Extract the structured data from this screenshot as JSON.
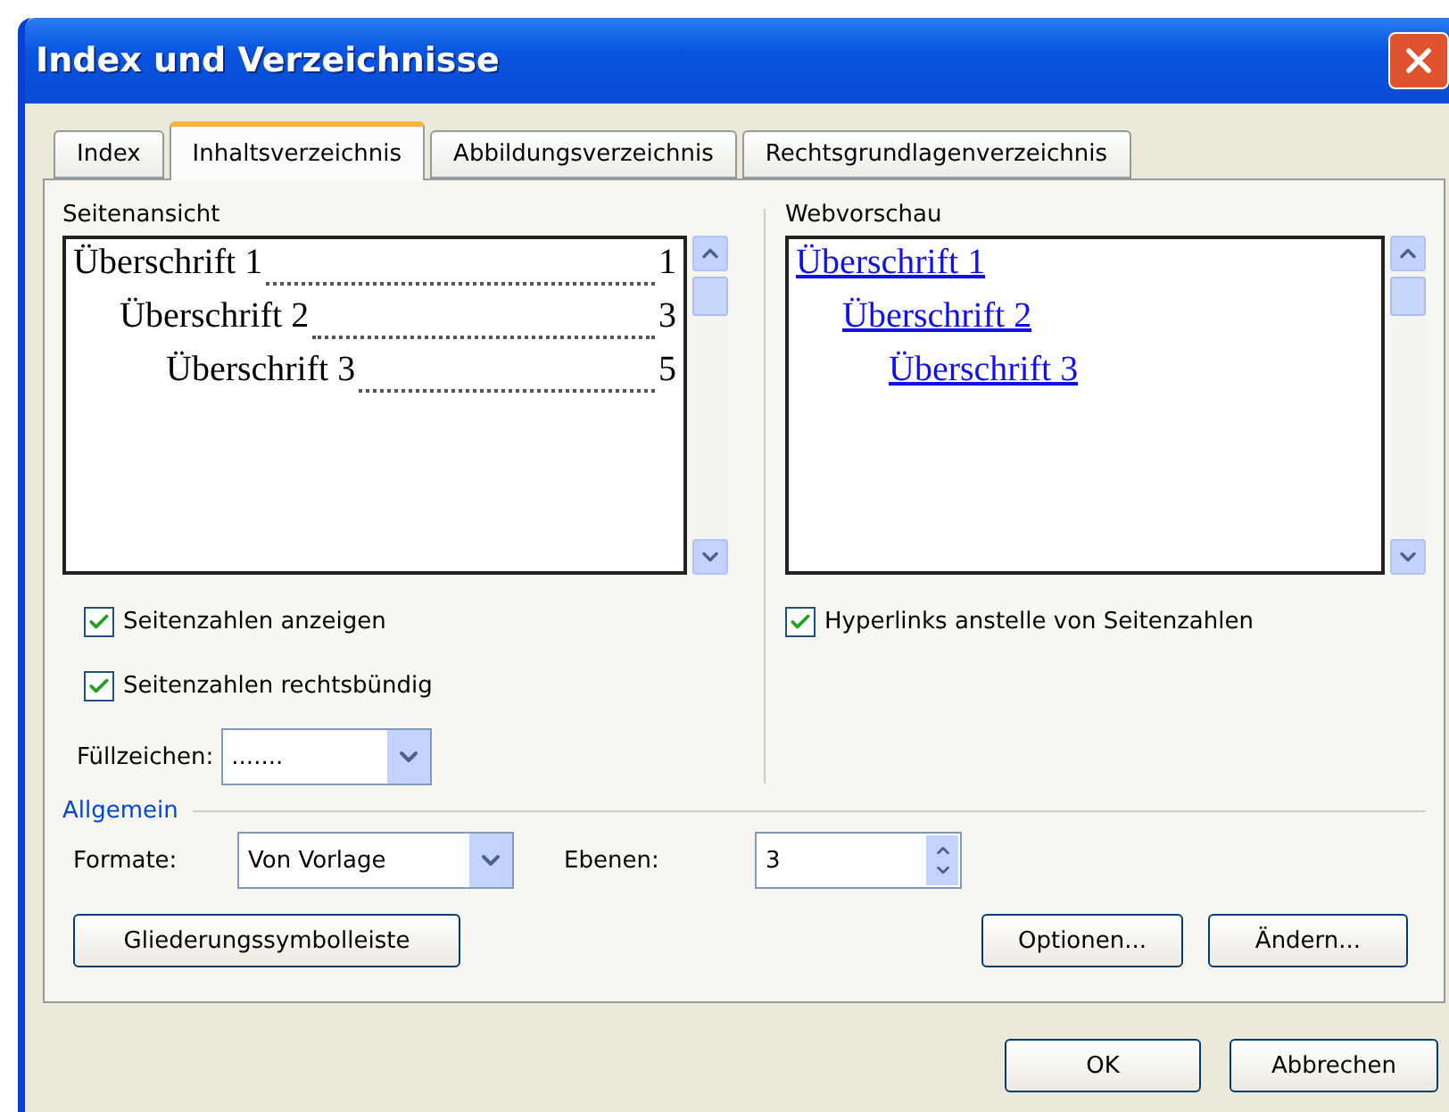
{
  "window": {
    "title": "Index und Verzeichnisse"
  },
  "tabs": [
    {
      "label": "Index",
      "selected": false
    },
    {
      "label": "Inhaltsverzeichnis",
      "selected": true
    },
    {
      "label": "Abbildungsverzeichnis",
      "selected": false
    },
    {
      "label": "Rechtsgrundlagenverzeichnis",
      "selected": false
    }
  ],
  "print_preview": {
    "label": "Seitenansicht",
    "entries": [
      {
        "text": "Überschrift 1",
        "page": "1",
        "children": [
          {
            "text": "Überschrift 2",
            "page": "3",
            "children": [
              {
                "text": "Überschrift 3",
                "page": "5"
              }
            ]
          }
        ]
      }
    ]
  },
  "web_preview": {
    "label": "Webvorschau",
    "entries": [
      {
        "text": "Überschrift 1",
        "children": [
          {
            "text": "Überschrift 2",
            "children": [
              {
                "text": "Überschrift 3"
              }
            ]
          }
        ]
      }
    ]
  },
  "print_options": [
    {
      "label": "Seitenzahlen anzeigen",
      "checked": true
    },
    {
      "label": "Seitenzahlen rechtsbündig",
      "checked": true
    }
  ],
  "tab_leader": {
    "label": "Füllzeichen:",
    "value": "......."
  },
  "web_options": [
    {
      "label": "Hyperlinks anstelle von Seitenzahlen",
      "checked": true
    }
  ],
  "general": {
    "title": "Allgemein",
    "formats": {
      "label": "Formate:",
      "value": "Von Vorlage"
    },
    "levels": {
      "label": "Ebenen:",
      "value": "3"
    }
  },
  "panel_buttons": [
    "Gliederungssymbolleiste",
    "Optionen...",
    "Ändern..."
  ],
  "dialog_buttons": [
    "OK",
    "Abbrechen"
  ]
}
